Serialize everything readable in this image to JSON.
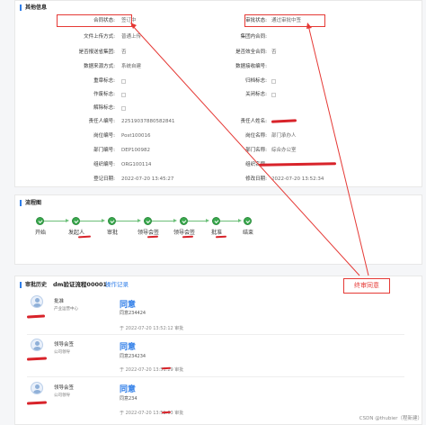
{
  "other_info": {
    "title": "其他信息",
    "rows": [
      {
        "left_label": "合同状态:",
        "left_value": "签订中",
        "right_label": "审批状态:",
        "right_value": "通过审批中签"
      },
      {
        "left_label": "文件上传方式:",
        "left_value": "普通上传",
        "right_label": "集团内合同:",
        "right_value": ""
      },
      {
        "left_label": "是否报送省集团:",
        "left_value": "否",
        "right_label": "是否效全合同:",
        "right_value": "否"
      },
      {
        "left_label": "数据来源方式:",
        "left_value": "系统自建",
        "right_label": "数据接收编号:",
        "right_value": ""
      },
      {
        "left_label": "重章标志:",
        "left_value": "",
        "right_label": "归档标志:",
        "right_value": ""
      },
      {
        "left_label": "作废标志:",
        "left_value": "",
        "right_label": "关闭标志:",
        "right_value": ""
      },
      {
        "left_label": "解除标志:",
        "left_value": "",
        "right_label": "",
        "right_value": ""
      },
      {
        "left_label": "责任人编号:",
        "left_value": "22519037880582841",
        "right_label": "责任人姓名:",
        "right_value": ""
      },
      {
        "left_label": "岗位编号:",
        "left_value": "Post100016",
        "right_label": "岗位名称:",
        "right_value": "部门承办人"
      },
      {
        "left_label": "部门编号:",
        "left_value": "DEP100982",
        "right_label": "部门名称:",
        "right_value": "综合办公室"
      },
      {
        "left_label": "组织编号:",
        "left_value": "ORG100114",
        "right_label": "组织名称:",
        "right_value": ""
      },
      {
        "left_label": "登记日期:",
        "left_value": "2022-07-20 13:45:27",
        "right_label": "修改日期:",
        "right_value": "2022-07-20 13:52:34"
      }
    ]
  },
  "flow": {
    "title": "流程图",
    "steps": [
      "开始",
      "发起人",
      "审批",
      "领导会签",
      "领导会签",
      "批准",
      "结束"
    ]
  },
  "history": {
    "title": "审批历史",
    "process_name": "dm验证流程00001",
    "log_link": "操作记录",
    "entries": [
      {
        "role": "批准",
        "org": "产业运营中心",
        "result": "同意",
        "comment": "同意234424",
        "time": "2022-07-20 13:52:12",
        "tag": "审批"
      },
      {
        "role": "领导会签",
        "org": "公司领导",
        "result": "同意",
        "comment": "同意234234",
        "time": "2022-07-20 13:51:29",
        "tag": "审批"
      },
      {
        "role": "领导会签",
        "org": "公司领导",
        "result": "同意",
        "comment": "同意234",
        "time": "2022-07-20 13:51:03",
        "tag": "审批"
      }
    ]
  },
  "annotation": {
    "label": "终审同意"
  },
  "watermark": "CSDN @thubier（程新建）",
  "colors": {
    "accent": "#2f7ee8",
    "flow_green": "#3aa94e",
    "annotation_red": "#e53935"
  }
}
